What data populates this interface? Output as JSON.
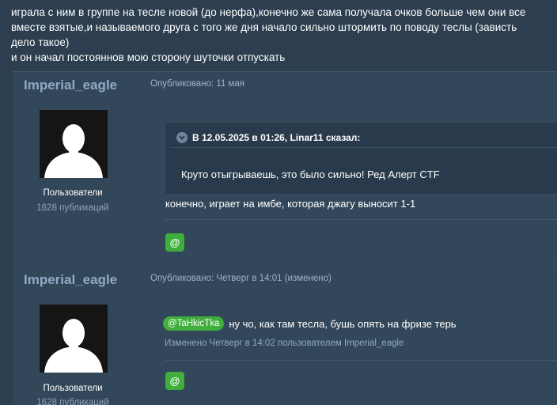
{
  "intro": {
    "line1": "играла с ним в группе на тесле новой (до нерфа),конечно же сама получала очков больше чем они все",
    "line2": "вместе взятые,и называемого друга с того же дня начало сильно штормить по поводу теслы (зависть",
    "line3": "дело такое)",
    "line4": "и он начал постояннов  мою сторону шуточки отпускать"
  },
  "posts": [
    {
      "author": "Imperial_eagle",
      "date": "Опубликовано: 11 мая",
      "group": "Пользователи",
      "count": "1628 публикаций",
      "quote_header": "В 12.05.2025 в 01:26, Linar11 сказал:",
      "quote_text": "Круто отыгрываешь, это было сильно! Ред Алерт CTF",
      "text": "конечно, играет на имбе, которая джагу выносит 1-1",
      "mention_button": "@"
    },
    {
      "author": "Imperial_eagle",
      "date": "Опубликовано: Четверг в 14:01 (изменено)",
      "group": "Пользователи",
      "count": "1628 публикаций",
      "mention": "@TaHkicTka",
      "text": "ну чо, как там тесла, бушь опять на фризе терь",
      "edited": "Изменено Четверг в 14:02 пользователем Imperial_eagle",
      "mention_button": "@"
    }
  ],
  "colors": {
    "background": "#2c3e4f",
    "post_bg": "#33475a",
    "author": "#8eaac4",
    "accent_green": "#3fae3c"
  },
  "icons": {
    "avatar": "default-user-silhouette",
    "quote_toggle": "chevron-down-icon"
  }
}
